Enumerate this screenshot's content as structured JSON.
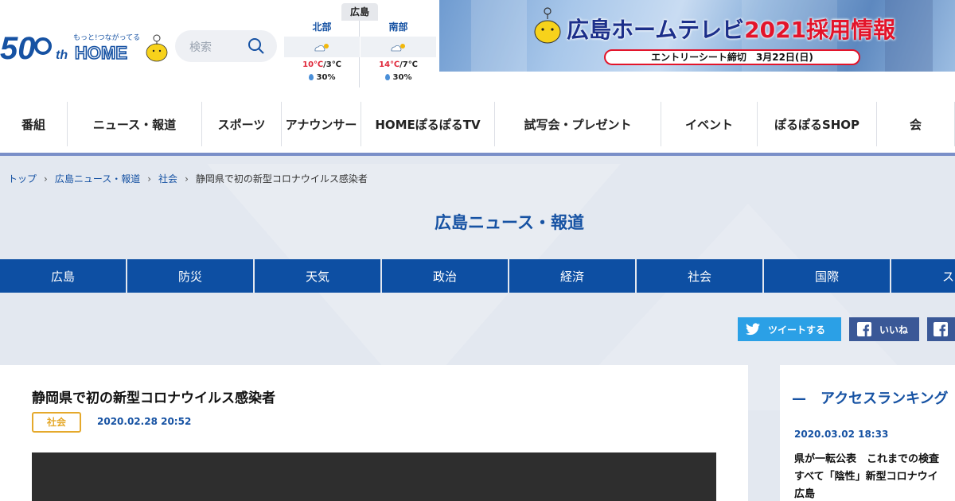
{
  "header": {
    "logo": {
      "anniv": "50",
      "th": "th",
      "tagline": "もっと!つながってる",
      "brand": "HOME"
    },
    "search": {
      "placeholder": "検索",
      "icon": "search-icon"
    }
  },
  "weather": {
    "tab": "広島",
    "north": {
      "name": "北部",
      "hi": "10℃",
      "lo": "3℃",
      "rain": "30%",
      "icon": "cloudy-sun-icon"
    },
    "south": {
      "name": "南部",
      "hi": "14℃",
      "lo": "7℃",
      "rain": "30%",
      "icon": "cloudy-sun-icon"
    }
  },
  "banner": {
    "brand": "広島ホームテレビ",
    "title": "2021採用情報",
    "pill": "エントリーシート締切　3月22日(日)"
  },
  "nav": [
    {
      "label": "番組",
      "w": 85
    },
    {
      "label": "ニュース・報道",
      "w": 169
    },
    {
      "label": "スポーツ",
      "w": 100
    },
    {
      "label": "アナウンサー",
      "w": 100
    },
    {
      "label": "HOMEぽるぽるTV",
      "w": 168
    },
    {
      "label": "試写会・プレゼント",
      "w": 209
    },
    {
      "label": "イベント",
      "w": 121
    },
    {
      "label": "ぽるぽるSHOP",
      "w": 150
    },
    {
      "label": "会",
      "w": 98
    }
  ],
  "breadcrumb": {
    "top": "トップ",
    "news": "広島ニュース・報道",
    "cat": "社会",
    "current": "静岡県で初の新型コロナウイルス感染者"
  },
  "section_title": "広島ニュース・報道",
  "categories": [
    "広島",
    "防災",
    "天気",
    "政治",
    "経済",
    "社会",
    "国際",
    "スポ"
  ],
  "share": {
    "tweet": "ツイートする",
    "like": "いいね"
  },
  "article": {
    "title": "静岡県で初の新型コロナウイルス感染者",
    "tag": "社会",
    "date": "2020.02.28 20:52"
  },
  "sidebar": {
    "ranking_title": "—　アクセスランキング",
    "item_date": "2020.03.02 18:33",
    "item_title_1": "県が一転公表　これまでの検査",
    "item_title_2": "すべて「陰性」新型コロナウイ",
    "item_title_3": "広島"
  },
  "colors": {
    "brand_blue": "#1652a3",
    "category_bar": "#0d4fa3",
    "twitter": "#2ba0e6",
    "facebook": "#3a5897",
    "tag_gold": "#e5a92b"
  }
}
